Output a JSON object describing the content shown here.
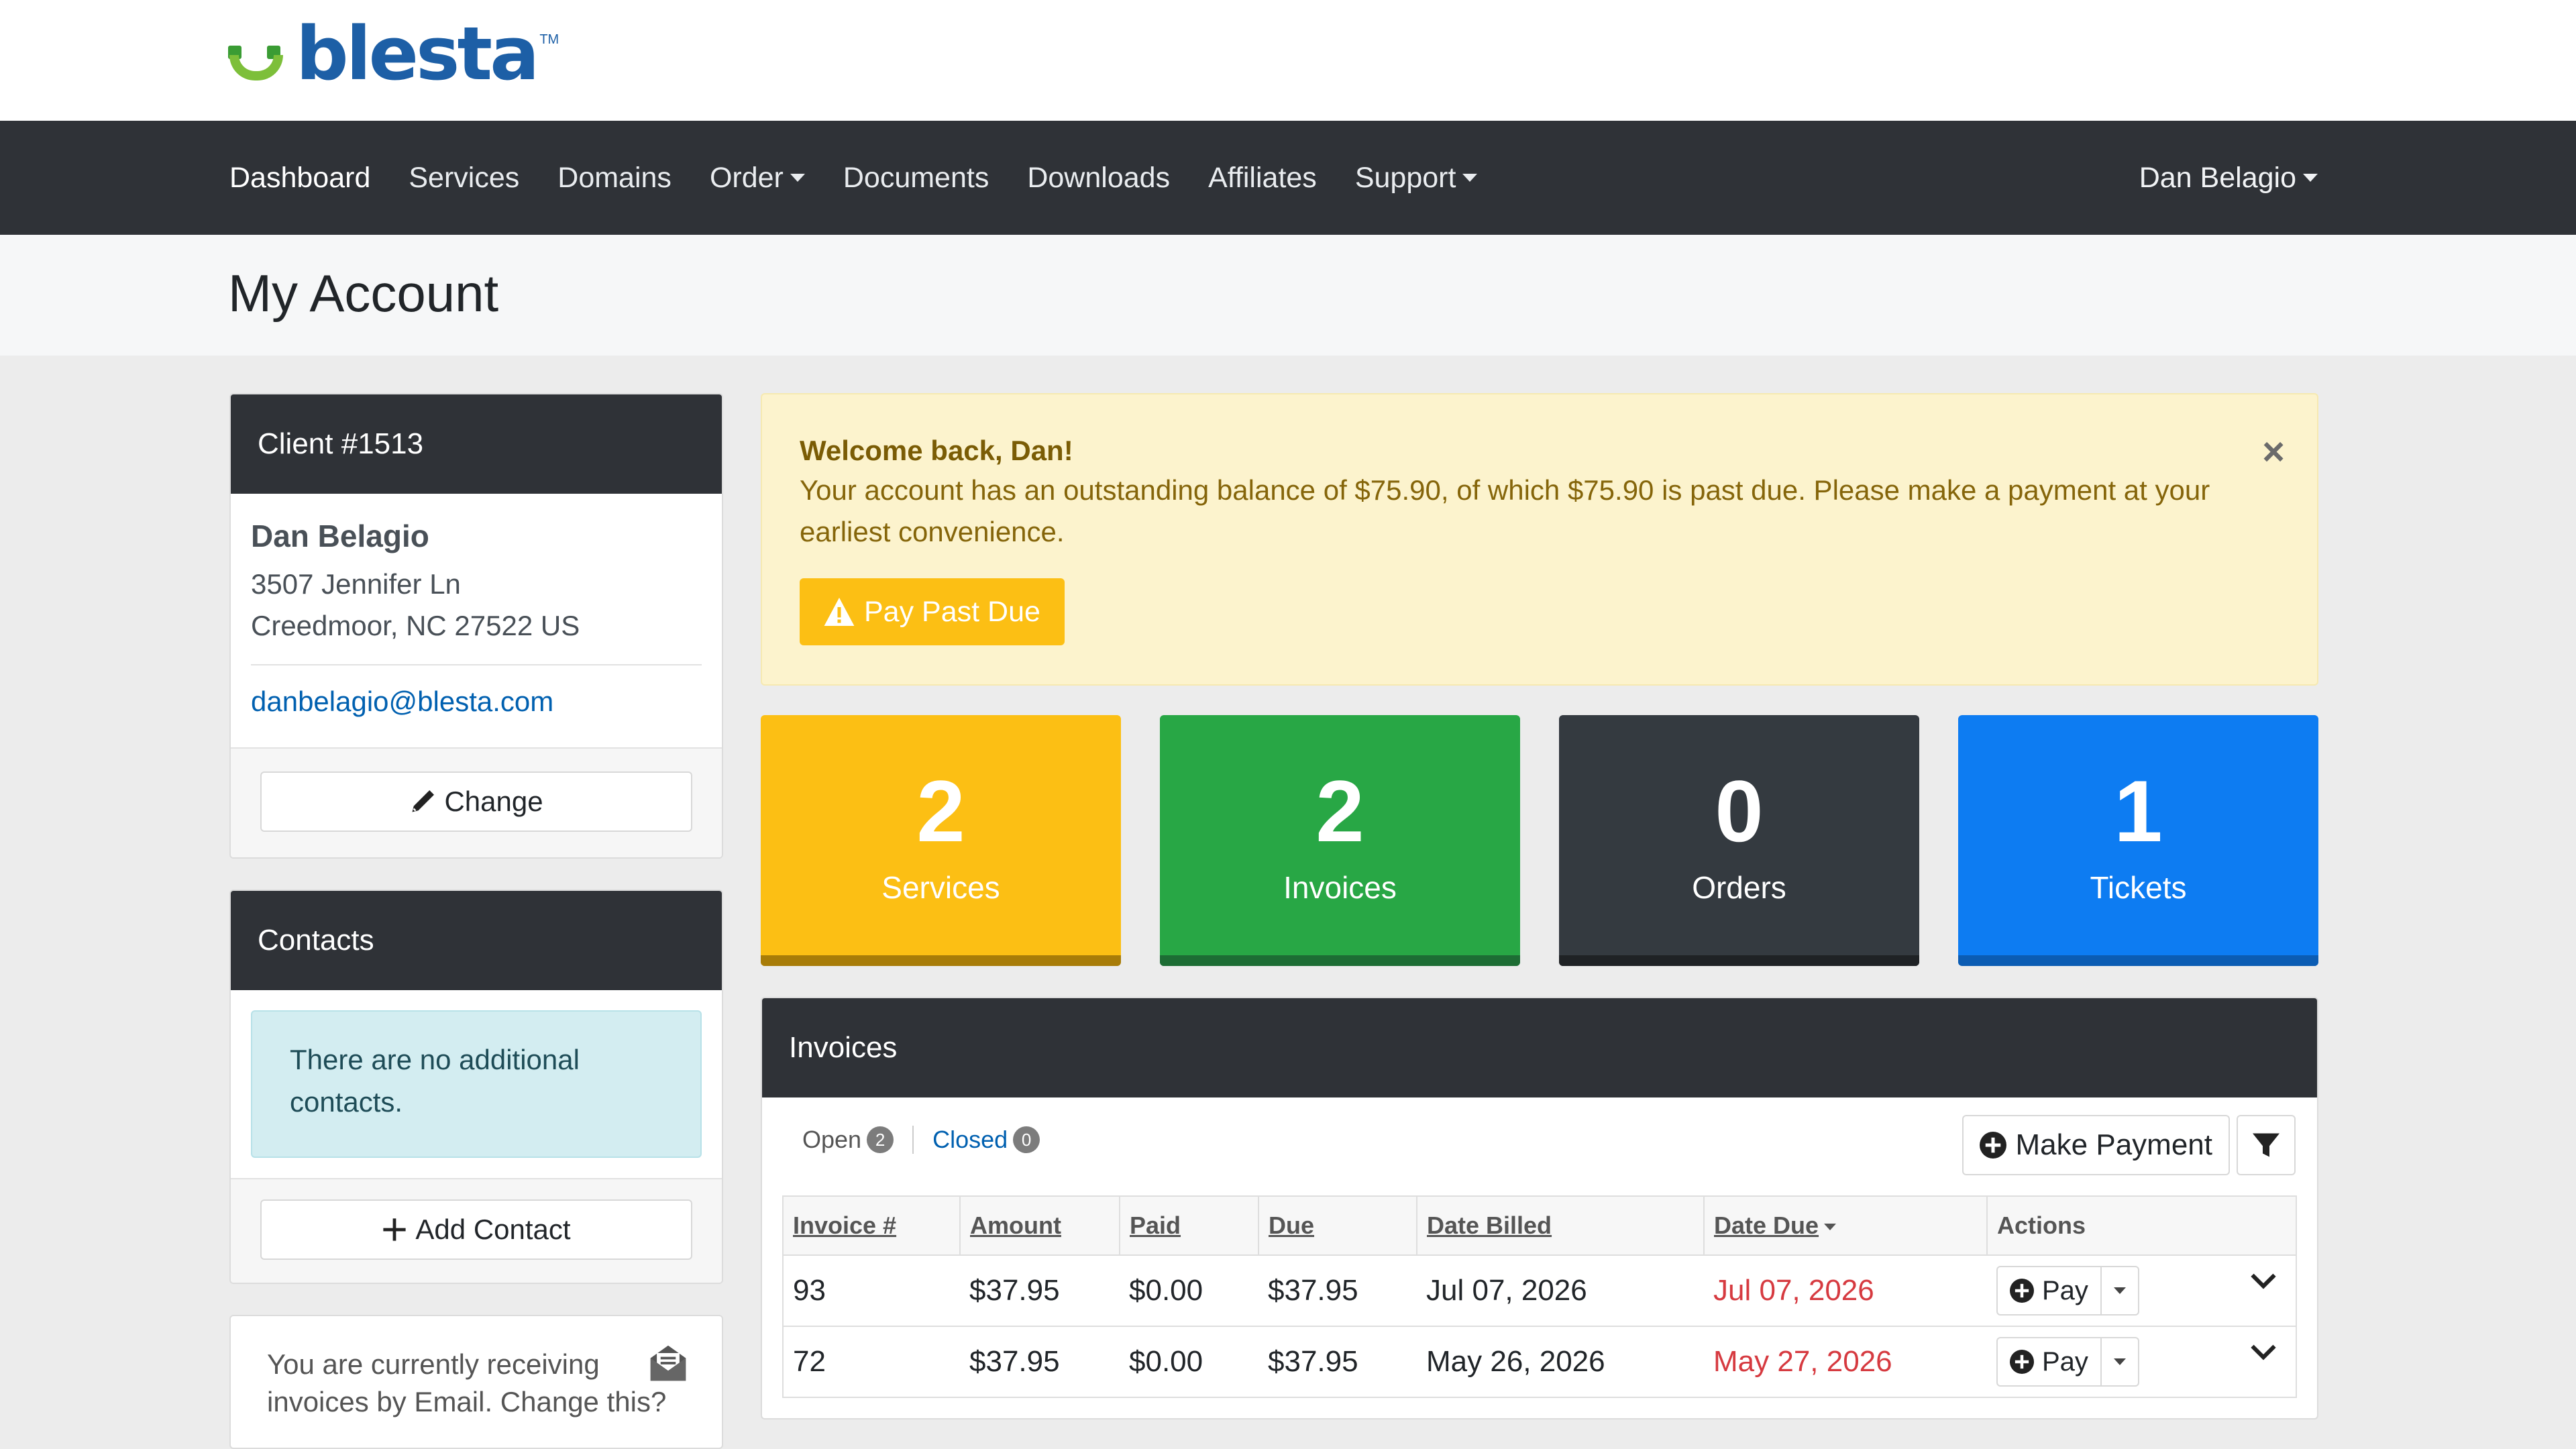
{
  "brand": {
    "name": "blesta",
    "tm": "TM",
    "colors": {
      "logo_blue": "#1d5fa6",
      "logo_green": "#7dbf3a"
    }
  },
  "nav": {
    "items": [
      {
        "label": "Dashboard",
        "active": true,
        "dropdown": false
      },
      {
        "label": "Services",
        "dropdown": false
      },
      {
        "label": "Domains",
        "dropdown": false
      },
      {
        "label": "Order",
        "dropdown": true
      },
      {
        "label": "Documents",
        "dropdown": false
      },
      {
        "label": "Downloads",
        "dropdown": false
      },
      {
        "label": "Affiliates",
        "dropdown": false
      },
      {
        "label": "Support",
        "dropdown": true
      }
    ],
    "user": "Dan Belagio"
  },
  "page": {
    "title": "My Account"
  },
  "client": {
    "heading": "Client #1513",
    "name": "Dan Belagio",
    "address1": "3507 Jennifer Ln",
    "address2": "Creedmoor, NC 27522 US",
    "email": "danbelagio@blesta.com",
    "change_label": "Change",
    "change_icon": "pencil-icon"
  },
  "contacts": {
    "heading": "Contacts",
    "empty_message": "There are no additional contacts.",
    "add_label": "Add Contact",
    "add_icon": "plus-icon"
  },
  "invoice_method": {
    "text": "You are currently receiving invoices by Email. Change this?",
    "icon": "envelope-open-icon"
  },
  "alert": {
    "title": "Welcome back, Dan!",
    "message": "Your account has an outstanding balance of $75.90, of which $75.90 is past due. Please make a payment at your earliest convenience.",
    "button_label": "Pay Past Due",
    "button_icon": "warning-triangle-icon",
    "close": "×"
  },
  "stats": [
    {
      "count": "2",
      "label": "Services",
      "color": "#fcbf14",
      "bar_color": "#a87c08"
    },
    {
      "count": "2",
      "label": "Invoices",
      "color": "#28a745",
      "bar_color": "#1d6d34"
    },
    {
      "count": "0",
      "label": "Orders",
      "color": "#343a40",
      "bar_color": "#1f2225"
    },
    {
      "count": "1",
      "label": "Tickets",
      "color": "#0d7cf2",
      "bar_color": "#0b5cb3"
    }
  ],
  "invoices": {
    "heading": "Invoices",
    "filter_open": {
      "label": "Open",
      "count": "2"
    },
    "filter_closed": {
      "label": "Closed",
      "count": "0"
    },
    "make_payment_label": "Make Payment",
    "columns": [
      "Invoice #",
      "Amount",
      "Paid",
      "Due",
      "Date Billed",
      "Date Due",
      "Actions"
    ],
    "rows": [
      {
        "invoice": "93",
        "amount": "$37.95",
        "paid": "$0.00",
        "due": "$37.95",
        "billed": "Jul 07, 2026",
        "date_due": "Jul 07, 2026",
        "action": "Pay"
      },
      {
        "invoice": "72",
        "amount": "$37.95",
        "paid": "$0.00",
        "due": "$37.95",
        "billed": "May 26, 2026",
        "date_due": "May 27, 2026",
        "action": "Pay"
      }
    ]
  }
}
